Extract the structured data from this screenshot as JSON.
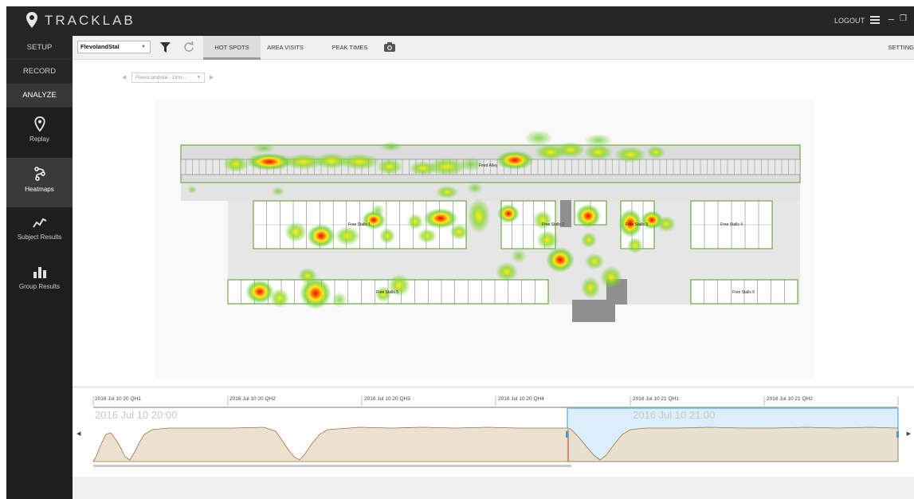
{
  "app": {
    "title": "TRACKLAB",
    "logout_label": "LOGOUT"
  },
  "nav": {
    "setup": "SETUP",
    "record": "RECORD",
    "analyze": "ANALYZE",
    "items": [
      {
        "label": "Replay",
        "icon": "map-pin-icon"
      },
      {
        "label": "Heatmaps",
        "icon": "heatmap-icon"
      },
      {
        "label": "Subject Results",
        "icon": "line-trend-icon"
      },
      {
        "label": "Group Results",
        "icon": "bar-chart-icon"
      }
    ]
  },
  "toolbar": {
    "dataset": "FlevolandStal",
    "tabs": [
      "HOT SPOTS",
      "AREA VISITS",
      "PEAK TIMES"
    ],
    "active_tab": "HOT SPOTS",
    "settings": "SETTING"
  },
  "zone_select": {
    "value": "FlevoLandstal - Drin..."
  },
  "floorplan": {
    "feed_alley": "Feed Alley",
    "stalls": {
      "s1": "Free Stalls 1",
      "s2": "Free Stalls 2",
      "s3": "Free Stalls 3",
      "s4": "Free Stalls 4",
      "s5": "Free Stalls 5",
      "s6": "Free Stalls 6"
    }
  },
  "timeline": {
    "ticks": [
      "2016 Jul 10 20 QH1",
      "2016 Jul 10 20 QH2",
      "2016 Jul 10 20 QH3",
      "2016 Jul 10 20 QH4",
      "2016 Jul 10 21 QH1",
      "2016 Jul 10 21 QH2"
    ],
    "hour_labels": [
      "2016 Jul 10 20:00",
      "2016 Jul 10 21:00"
    ]
  },
  "colors": {
    "titlebar": "#262626",
    "nav_bg": "#1e1e1e",
    "stall_outline": "#5a9a2a",
    "timeline_fill": "#e9dcc8",
    "timeline_line": "#a0733c",
    "selection_fill": "#d8ecf8",
    "selection_border": "#3a9fd8"
  }
}
